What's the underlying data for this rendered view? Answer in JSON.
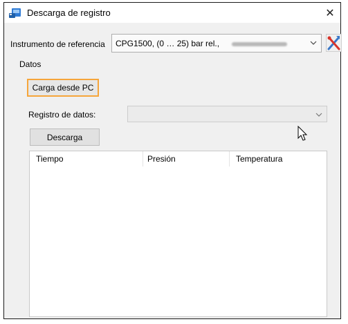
{
  "window": {
    "title": "Descarga de registro",
    "close_glyph": "✕",
    "icon": "data-logger-app-icon"
  },
  "reference": {
    "label": "Instrumento de referencia",
    "value": "CPG1500, (0 … 25) bar rel.,",
    "tool_icon": "tools-icon"
  },
  "datos": {
    "label": "Datos",
    "load_from_pc": "Carga desde PC",
    "highlight_color": "#f6a53a",
    "registro_label": "Registro de datos:",
    "registro_value": "",
    "download_button": "Descarga"
  },
  "table": {
    "columns": [
      "Tiempo",
      "Presión",
      "Temperatura"
    ],
    "rows": []
  }
}
